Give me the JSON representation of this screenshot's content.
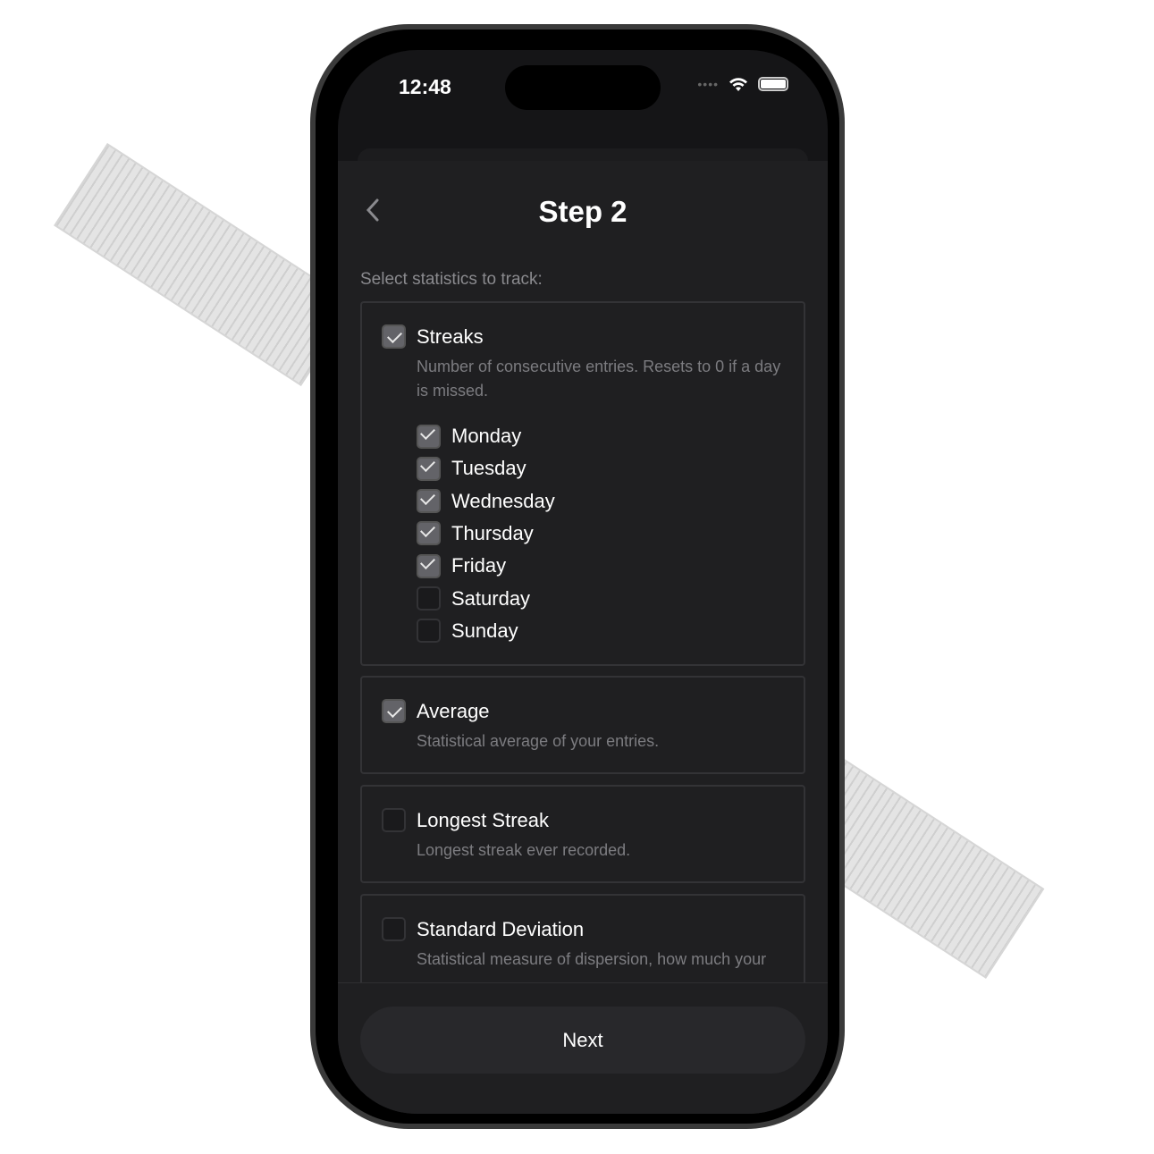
{
  "status_bar": {
    "time": "12:48",
    "signal_icon": "signal-dots-icon",
    "wifi_icon": "wifi-icon",
    "battery_icon": "battery-icon"
  },
  "header": {
    "title": "Step 2",
    "back_icon": "chevron-left-icon"
  },
  "prompt": "Select statistics to track:",
  "cards": [
    {
      "title": "Streaks",
      "checked": true,
      "description": "Number of consecutive entries. Resets to 0 if a day is missed.",
      "days": [
        {
          "label": "Monday",
          "checked": true
        },
        {
          "label": "Tuesday",
          "checked": true
        },
        {
          "label": "Wednesday",
          "checked": true
        },
        {
          "label": "Thursday",
          "checked": true
        },
        {
          "label": "Friday",
          "checked": true
        },
        {
          "label": "Saturday",
          "checked": false
        },
        {
          "label": "Sunday",
          "checked": false
        }
      ]
    },
    {
      "title": "Average",
      "checked": true,
      "description": "Statistical average of your entries."
    },
    {
      "title": "Longest Streak",
      "checked": false,
      "description": "Longest streak ever recorded."
    },
    {
      "title": "Standard Deviation",
      "checked": false,
      "description": "Statistical measure of dispersion, how much your entries vary."
    }
  ],
  "footer": {
    "next_label": "Next"
  },
  "colors": {
    "background": "#1f1f21",
    "checkbox_checked": "#636368",
    "button": "#28282b"
  }
}
